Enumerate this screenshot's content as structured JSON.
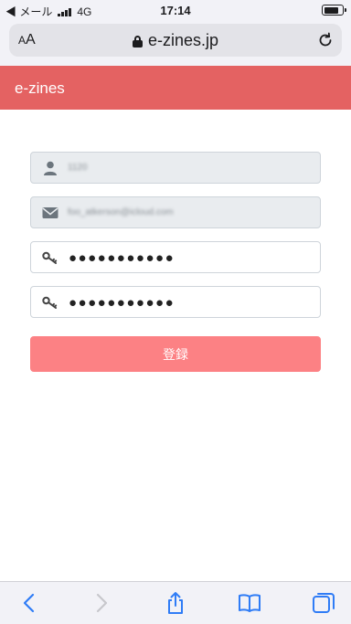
{
  "status_bar": {
    "back_app": "◀ メール",
    "network": "4G",
    "time": "17:14"
  },
  "browser": {
    "text_size_button": "AA",
    "url": "e-zines.jp"
  },
  "app": {
    "title": "e-zines"
  },
  "form": {
    "name_value": "1120",
    "email_value": "foo_atkerson@icloud.com",
    "password_mask": "●●●●●●●●●●●",
    "password_confirm_mask": "●●●●●●●●●●●",
    "submit_label": "登録"
  },
  "colors": {
    "header": "#e46262",
    "submit": "#fc8184",
    "toolbar_accent": "#2f7cf6"
  },
  "icons": [
    "user-icon",
    "envelope-icon",
    "key-icon",
    "back-icon",
    "forward-icon",
    "share-icon",
    "bookmarks-icon",
    "tabs-icon"
  ]
}
